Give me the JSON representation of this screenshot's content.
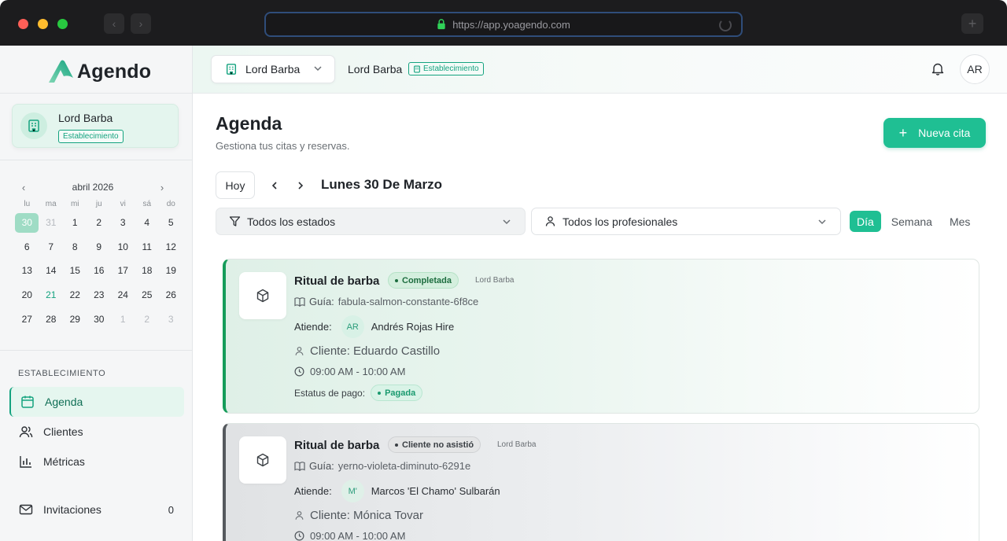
{
  "browser": {
    "url": "https://app.yoagendo.com"
  },
  "sidebar": {
    "logo_text": "Agendo",
    "establishment": {
      "name": "Lord Barba",
      "tag": "Establecimiento"
    },
    "calendar": {
      "month_label": "abril 2026",
      "weekdays": [
        "lu",
        "ma",
        "mi",
        "ju",
        "vi",
        "sá",
        "do"
      ],
      "days": [
        {
          "d": "30",
          "state": "selected"
        },
        {
          "d": "31",
          "state": "out"
        },
        {
          "d": "1"
        },
        {
          "d": "2"
        },
        {
          "d": "3"
        },
        {
          "d": "4"
        },
        {
          "d": "5"
        },
        {
          "d": "6"
        },
        {
          "d": "7"
        },
        {
          "d": "8"
        },
        {
          "d": "9"
        },
        {
          "d": "10"
        },
        {
          "d": "11"
        },
        {
          "d": "12"
        },
        {
          "d": "13"
        },
        {
          "d": "14"
        },
        {
          "d": "15"
        },
        {
          "d": "16"
        },
        {
          "d": "17"
        },
        {
          "d": "18"
        },
        {
          "d": "19"
        },
        {
          "d": "20"
        },
        {
          "d": "21",
          "state": "today"
        },
        {
          "d": "22"
        },
        {
          "d": "23"
        },
        {
          "d": "24"
        },
        {
          "d": "25"
        },
        {
          "d": "26"
        },
        {
          "d": "27"
        },
        {
          "d": "28"
        },
        {
          "d": "29"
        },
        {
          "d": "30"
        },
        {
          "d": "1",
          "state": "out"
        },
        {
          "d": "2",
          "state": "out"
        },
        {
          "d": "3",
          "state": "out"
        }
      ]
    },
    "section_label": "ESTABLECIMIENTO",
    "nav": [
      {
        "label": "Agenda",
        "icon": "calendar-icon",
        "active": true
      },
      {
        "label": "Clientes",
        "icon": "users-icon"
      },
      {
        "label": "Métricas",
        "icon": "bar-chart-icon"
      },
      {
        "label": "Invitaciones",
        "icon": "mail-icon",
        "count": "0"
      }
    ]
  },
  "topbar": {
    "establishment_select": "Lord Barba",
    "establishment_name": "Lord Barba",
    "establishment_tag": "Establecimiento",
    "avatar_initials": "AR"
  },
  "main": {
    "title": "Agenda",
    "subtitle": "Gestiona tus citas y reservas.",
    "new_button": "Nueva cita",
    "today_button": "Hoy",
    "date_label": "Lunes 30 De Marzo",
    "filter_states": "Todos los estados",
    "filter_professionals": "Todos los profesionales",
    "views": [
      "Día",
      "Semana",
      "Mes"
    ],
    "active_view": "Día"
  },
  "appointments": [
    {
      "service": "Ritual de barba",
      "status": "Completada",
      "location": "Lord Barba",
      "guide_label": "Guía:",
      "guide": "fabula-salmon-constante-6f8ce",
      "attend_label": "Atiende:",
      "staff_initials": "AR",
      "staff_name": "Andrés Rojas Hire",
      "client": "Cliente: Eduardo Castillo",
      "time": "09:00 AM - 10:00 AM",
      "payment_label": "Estatus de pago:",
      "payment_status": "Pagada"
    },
    {
      "service": "Ritual de barba",
      "status": "Cliente no asistió",
      "location": "Lord Barba",
      "guide_label": "Guía:",
      "guide": "yerno-violeta-diminuto-6291e",
      "attend_label": "Atiende:",
      "staff_initials": "M'",
      "staff_name": "Marcos 'El Chamo' Sulbarán",
      "client": "Cliente: Mónica Tovar",
      "time": "09:00 AM - 10:00 AM"
    }
  ],
  "colors": {
    "accent": "#1fbf93",
    "completed_border": "#169c5a",
    "noshow_border": "#55595e"
  }
}
